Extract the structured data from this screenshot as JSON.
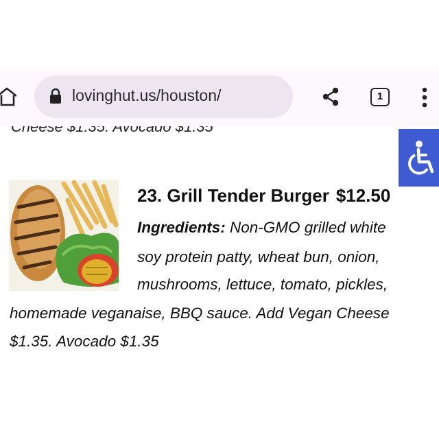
{
  "browser": {
    "url": "lovinghut.us/houston/",
    "tab_count": "1"
  },
  "previous_item": {
    "text": "Cheese $1.35. Avocado $1.35"
  },
  "menu_item": {
    "title": "23. Grill Tender Burger",
    "price": "$12.50",
    "ingredients_label": "Ingredients:",
    "line1": " Non-GMO grilled white",
    "line2": "soy protein patty, wheat bun, onion,",
    "line3": "mushrooms, lettuce, tomato, pickles,",
    "line4": "homemade veganaise, BBQ sauce. Add Vegan Cheese",
    "line5": "$1.35. Avocado $1.35"
  },
  "colors": {
    "toolbar_bg": "#fdf8fd",
    "urlbar_bg": "#ede6f0",
    "accessibility_blue": "#3f5bd1"
  },
  "icons": [
    "home-icon",
    "lock-icon",
    "share-icon",
    "tab-switcher-icon",
    "more-vert-icon",
    "accessibility-icon"
  ]
}
